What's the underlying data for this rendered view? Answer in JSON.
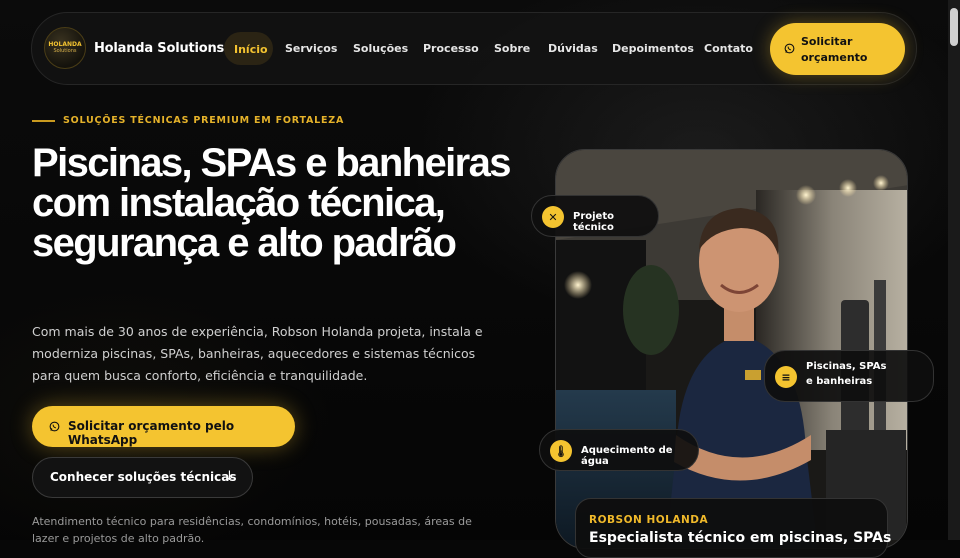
{
  "nav": {
    "logo_line1": "HOLANDA",
    "logo_line2": "Solutions",
    "brand": "Holanda Solutions",
    "links": [
      "Início",
      "Serviços",
      "Soluções",
      "Processo",
      "Sobre",
      "Dúvidas",
      "Depoimentos",
      "Contato"
    ],
    "active_link": "Início",
    "cta_label": "Solicitar orçamento",
    "cta_icon": "whatsapp-icon"
  },
  "hero": {
    "eyebrow": "SOLUÇÕES TÉCNICAS PREMIUM EM FORTALEZA",
    "headline": "Piscinas, SPAs e banheiras com instalação técnica, segurança e alto padrão",
    "lead": "Com mais de 30 anos de experiência, Robson Holanda projeta, instala e moderniza piscinas, SPAs, banheiras, aquecedores e sistemas técnicos para quem busca conforto, eficiência e tranquilidade.",
    "primary_button": "Solicitar orçamento pelo WhatsApp",
    "secondary_button": "Conhecer soluções técnicas",
    "secondary_icon": "arrow-down-icon",
    "footnote": "Atendimento técnico para residências, condomínios, hotéis, pousadas, áreas de lazer e projetos de alto padrão."
  },
  "feature_chips": [
    {
      "label": "Projeto técnico",
      "icon": "tools-icon"
    },
    {
      "label": "Piscinas, SPAs e banheiras",
      "icon": "list-icon"
    },
    {
      "label": "Aquecimento de água",
      "icon": "thermometer-icon"
    }
  ],
  "profile": {
    "name": "ROBSON HOLANDA",
    "role": "Especialista técnico em piscinas, SPAs"
  },
  "colors": {
    "accent": "#f4c430",
    "background": "#070707",
    "card": "#121212"
  }
}
